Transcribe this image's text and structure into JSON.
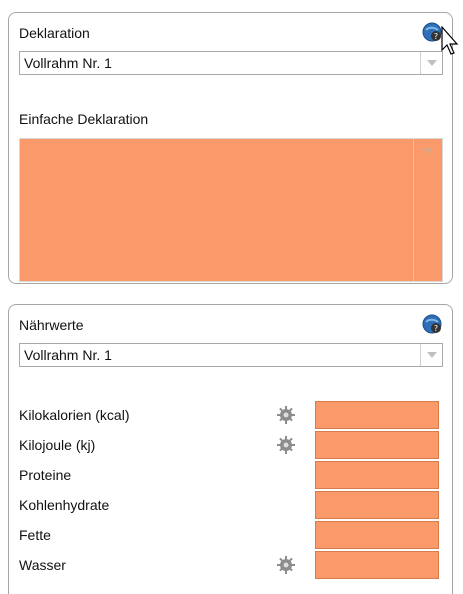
{
  "deklaration": {
    "title": "Deklaration",
    "select_value": "Vollrahm Nr. 1",
    "einfache_label": "Einfache Deklaration",
    "help_icon": "help-globe-icon"
  },
  "naehrwerte": {
    "title": "Nährwerte",
    "select_value": "Vollrahm Nr. 1",
    "help_icon": "help-globe-icon",
    "rows": [
      {
        "label": "Kilokalorien (kcal)",
        "gear": true
      },
      {
        "label": "Kilojoule (kj)",
        "gear": true
      },
      {
        "label": "Proteine",
        "gear": false
      },
      {
        "label": "Kohlenhydrate",
        "gear": false
      },
      {
        "label": "Fette",
        "gear": false
      },
      {
        "label": "Wasser",
        "gear": true
      }
    ]
  },
  "colors": {
    "field_fill": "#fa9a6a",
    "border": "#a6a6a6"
  }
}
